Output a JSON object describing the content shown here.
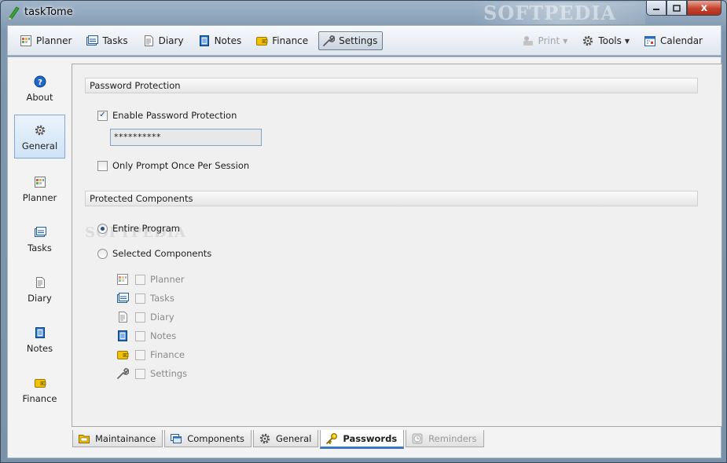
{
  "window": {
    "title": "taskTome",
    "watermark": "SOFTPEDIA",
    "controls": {
      "minimize": "–",
      "maximize": "□",
      "close": "x"
    }
  },
  "toolbar": {
    "items": [
      {
        "label": "Planner",
        "icon": "planner-icon"
      },
      {
        "label": "Tasks",
        "icon": "tasks-icon"
      },
      {
        "label": "Diary",
        "icon": "diary-icon"
      },
      {
        "label": "Notes",
        "icon": "notes-icon"
      },
      {
        "label": "Finance",
        "icon": "finance-icon"
      },
      {
        "label": "Settings",
        "icon": "wrench-icon",
        "active": true
      }
    ],
    "right": [
      {
        "label": "Print",
        "icon": "printer-icon",
        "disabled": true,
        "dropdown": "▼"
      },
      {
        "label": "Tools",
        "icon": "gear-icon",
        "dropdown": "▼"
      },
      {
        "label": "Calendar",
        "icon": "calendar-icon"
      }
    ]
  },
  "leftnav": {
    "items": [
      {
        "label": "About",
        "icon": "help-icon"
      },
      {
        "label": "General",
        "icon": "gear-icon",
        "active": true
      },
      {
        "label": "Planner",
        "icon": "planner-icon"
      },
      {
        "label": "Tasks",
        "icon": "tasks-icon"
      },
      {
        "label": "Diary",
        "icon": "diary-icon"
      },
      {
        "label": "Notes",
        "icon": "notes-icon"
      },
      {
        "label": "Finance",
        "icon": "finance-icon"
      }
    ]
  },
  "password_section": {
    "title": "Password Protection",
    "enable_label": "Enable Password Protection",
    "enable_checked": true,
    "password_value": "**********",
    "once_label": "Only Prompt Once Per Session",
    "once_checked": false
  },
  "components_section": {
    "title": "Protected Components",
    "entire_label": "Entire Program",
    "selected_label": "Selected Components",
    "selected_option": "Entire Program",
    "watermark": "SOFTPEDIA",
    "components": [
      {
        "label": "Planner",
        "icon": "planner-icon"
      },
      {
        "label": "Tasks",
        "icon": "tasks-icon"
      },
      {
        "label": "Diary",
        "icon": "diary-icon"
      },
      {
        "label": "Notes",
        "icon": "notes-icon"
      },
      {
        "label": "Finance",
        "icon": "finance-icon"
      },
      {
        "label": "Settings",
        "icon": "wrench-icon"
      }
    ]
  },
  "tabs": [
    {
      "label": "Maintainance",
      "icon": "folder-icon"
    },
    {
      "label": "Components",
      "icon": "windows-icon"
    },
    {
      "label": "General",
      "icon": "gear-icon"
    },
    {
      "label": "Passwords",
      "icon": "key-icon",
      "active": true
    },
    {
      "label": "Reminders",
      "icon": "clock-icon",
      "disabled": true
    }
  ],
  "colors": {
    "accent": "#3b78c4",
    "notes_blue": "#1d6fc7",
    "finance_yellow": "#e6b400",
    "help_blue": "#1f67c9"
  }
}
